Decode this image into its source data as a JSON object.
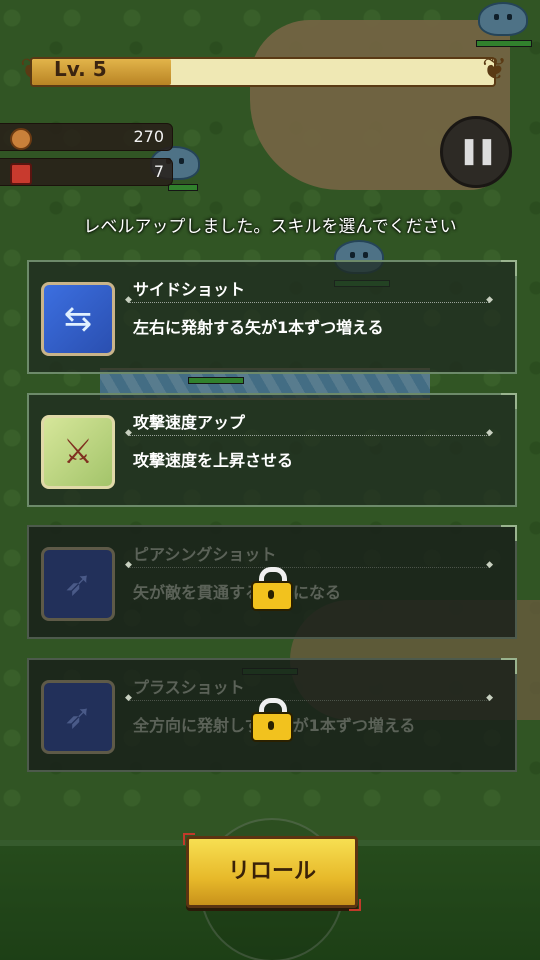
{
  "hud": {
    "level_label": "Lv. 5",
    "level_progress": 0.3,
    "coins": "270",
    "chests": "7",
    "pause_icon": "pause-icon"
  },
  "prompt": "レベルアップしました。スキルを選んでください",
  "skills": [
    {
      "title": "サイドショット",
      "desc": "左右に発射する矢が1本ずつ増える",
      "icon": "side-shot-arrows-icon",
      "locked": false
    },
    {
      "title": "攻撃速度アップ",
      "desc": "攻撃速度を上昇させる",
      "icon": "attack-speed-sword-icon",
      "locked": false
    },
    {
      "title": "ピアシングショット",
      "desc": "矢が敵を貫通するようになる",
      "icon": "piercing-arrow-icon",
      "locked": true
    },
    {
      "title": "プラスショット",
      "desc": "全方向に発射しする矢が1本ずつ増える",
      "icon": "plus-shot-arrow-icon",
      "locked": true
    }
  ],
  "reroll_label": "リロール",
  "colors": {
    "accent_gold": "#f2c21e",
    "card_border": "#6d8a6a",
    "grass": "#4f8a3a"
  }
}
